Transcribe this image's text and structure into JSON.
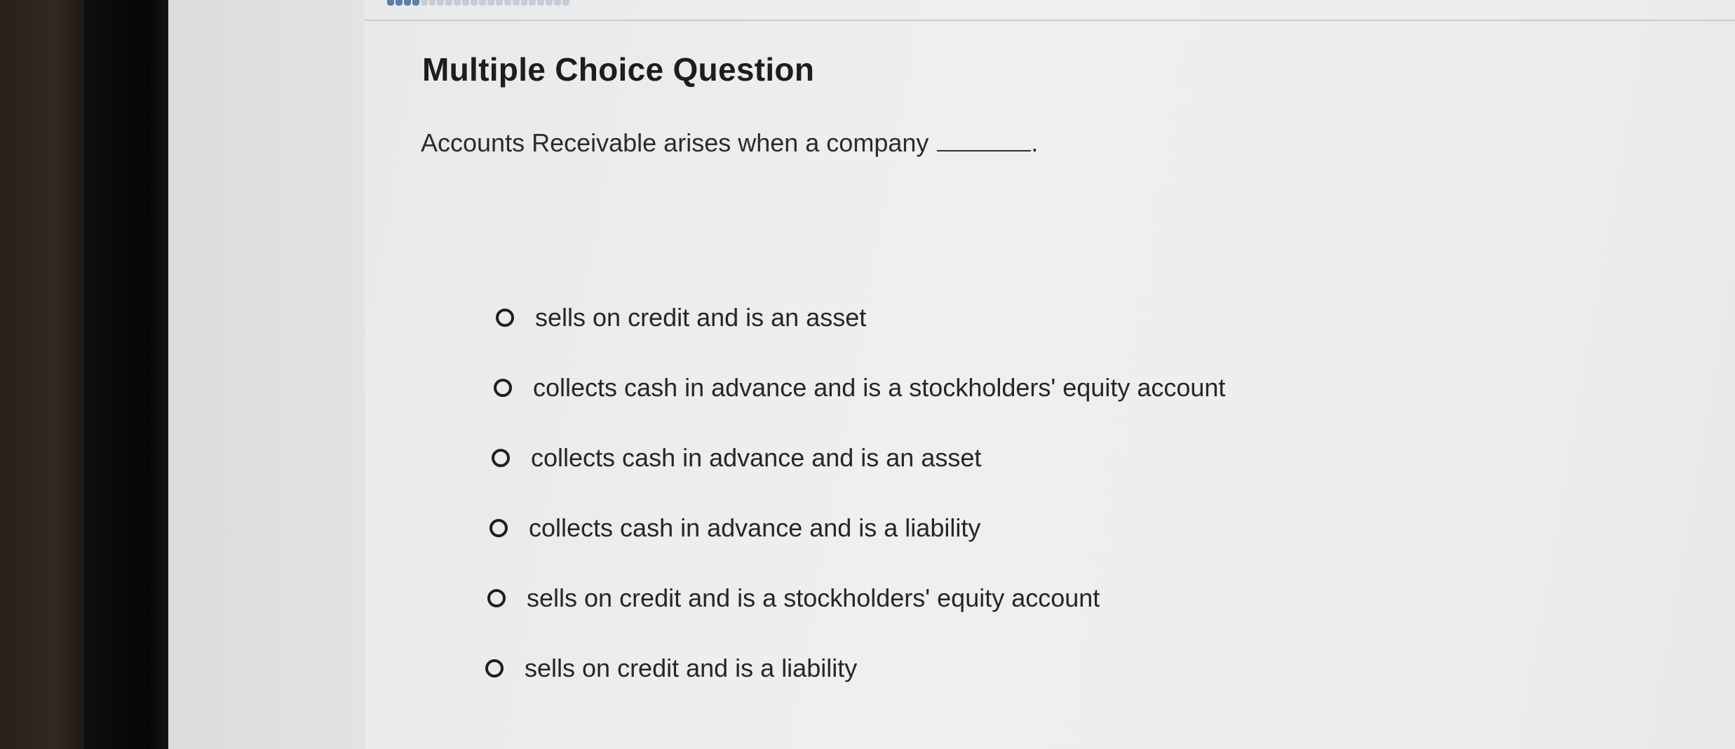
{
  "question": {
    "heading": "Multiple Choice Question",
    "prompt": "Accounts Receivable arises when a company",
    "prompt_end": "."
  },
  "options": [
    {
      "label": "sells on credit and is an asset"
    },
    {
      "label": "collects cash in advance and is a stockholders' equity account"
    },
    {
      "label": "collects cash in advance and is an asset"
    },
    {
      "label": "collects cash in advance and is a liability"
    },
    {
      "label": "sells on credit and is a stockholders' equity account"
    },
    {
      "label": "sells on credit and is a liability"
    }
  ],
  "progress": {
    "completed_fraction": 0.18
  },
  "colors": {
    "progress_filled": "#5a7fa8",
    "progress_empty": "#c5cdd6",
    "text": "#262626"
  }
}
